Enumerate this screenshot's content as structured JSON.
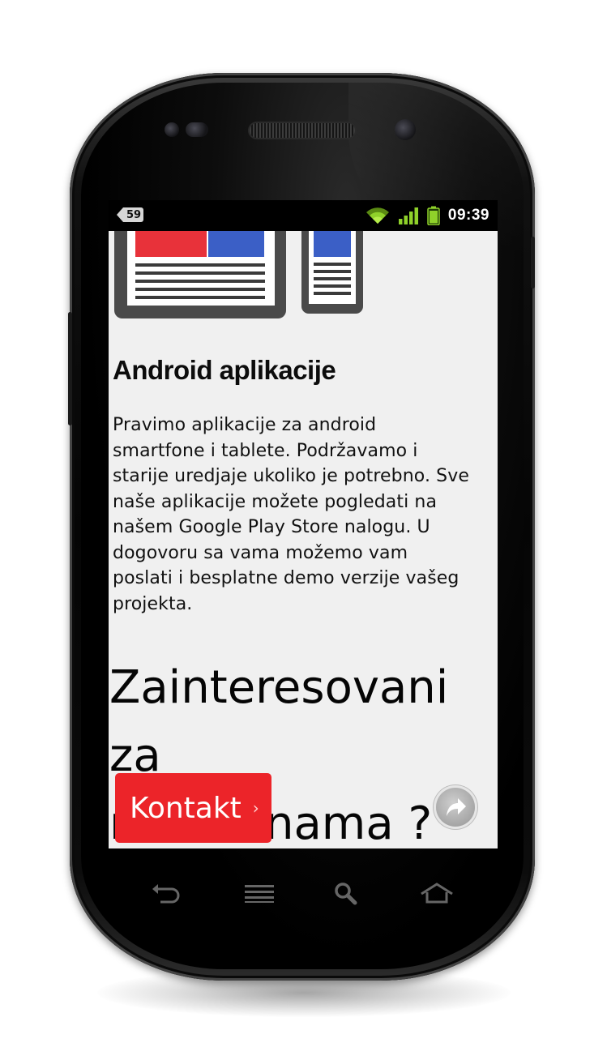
{
  "status_bar": {
    "notification_count": "59",
    "time": "09:39",
    "icons": [
      "wifi-icon",
      "signal-icon",
      "battery-icon"
    ]
  },
  "content": {
    "heading": "Android aplikacije",
    "body_lines": [
      "Pravimo aplikacije za android",
      "smartfone i tablete. Podržavamo i",
      "starije uredjaje ukoliko je potrebno. Sve",
      "naše aplikacije možete pogledati na",
      "našem Google Play Store nalogu. U",
      "dogovoru sa vama možemo vam",
      "poslati i besplatne demo verzije vašeg",
      "projekta."
    ],
    "cta_lines": [
      "Zainteresovani za",
      "rad sa nama ?"
    ],
    "button": {
      "label": "Kontakt",
      "chevron": "›"
    },
    "fab_icon": "share-arrow-icon"
  },
  "nav_keys": [
    "back-icon",
    "menu-icon",
    "search-icon",
    "home-icon"
  ],
  "colors": {
    "accent_red": "#ec2429",
    "accent_blue": "#3b5fc6",
    "screen_bg": "#f0f0f0",
    "status_green": "#8fd12a"
  }
}
